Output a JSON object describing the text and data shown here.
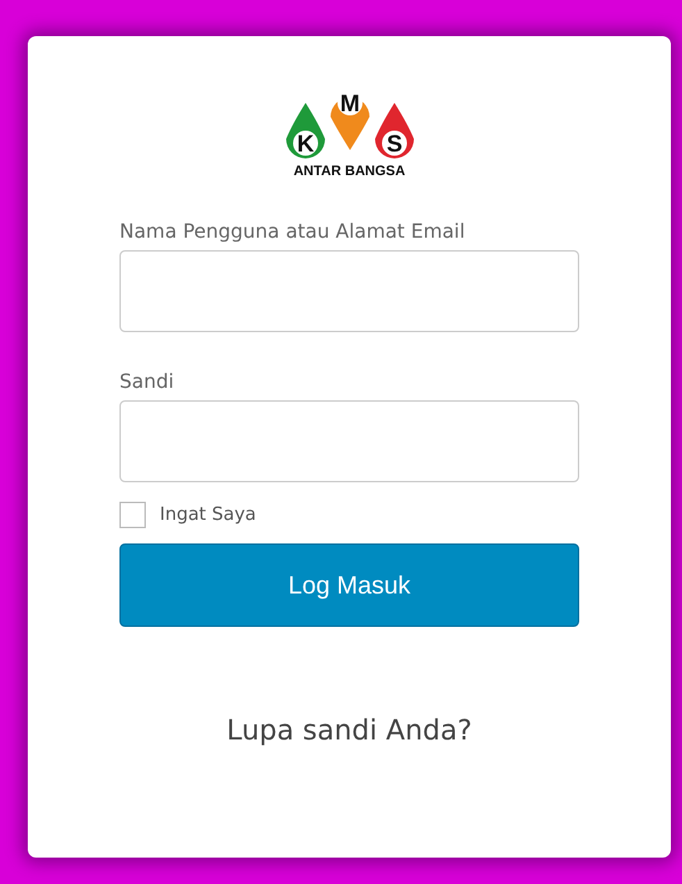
{
  "logo": {
    "letters": [
      "M",
      "K",
      "S"
    ],
    "caption": "ANTAR BANGSA"
  },
  "fields": [
    {
      "label": "Nama Pengguna atau Alamat Email"
    },
    {
      "label": "Sandi"
    }
  ],
  "remember": {
    "label": "Ingat Saya",
    "checked": false
  },
  "submit": "Log Masuk",
  "forgot_link": "Lupa sandi Anda?"
}
